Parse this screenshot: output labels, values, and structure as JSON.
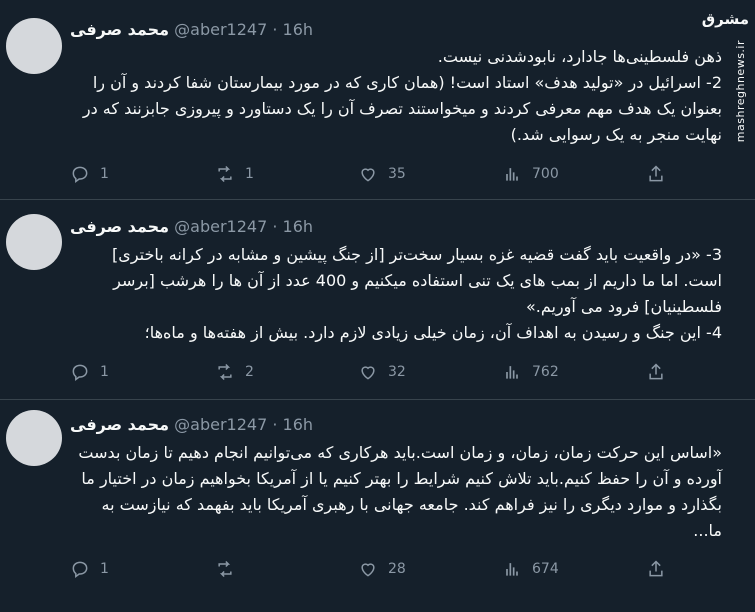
{
  "watermark": {
    "logo_text": "مشرق",
    "site": "mashreghnews.ir"
  },
  "tweets": [
    {
      "name": "محمد صرفی",
      "handle": "@aber1247",
      "time": "16h",
      "lines": [
        "ذهن فلسطینی‌ها جادارد، نابودشدنی نیست.",
        "2- اسرائیل در «تولید هدف» استاد است! (همان کاری که در مورد بیمارستان شفا کردند و آن را بعنوان یک هدف مهم معرفی کردند و میخواستند تصرف آن را یک دستاورد و پیروزی جابزنند که در نهایت منجر به یک رسوایی شد.)"
      ],
      "replies": "1",
      "retweets": "1",
      "likes": "35",
      "views": "700"
    },
    {
      "name": "محمد صرفی",
      "handle": "@aber1247",
      "time": "16h",
      "lines": [
        "3- «در واقعیت باید گفت قضیه غزه بسیار سخت‌تر [از جنگ پیشین و مشابه در کرانه باختری] است. اما ما داریم از بمب های یک تنی استفاده میکنیم و 400 عدد از آن ها را هرشب [برسر فلسطینیان] فرود می آوریم.»",
        "4- این جنگ و رسیدن به اهداف آن، زمان خیلی زیادی لازم دارد. بیش از هفته‌ها و ماه‌ها؛"
      ],
      "replies": "1",
      "retweets": "2",
      "likes": "32",
      "views": "762"
    },
    {
      "name": "محمد صرفی",
      "handle": "@aber1247",
      "time": "16h",
      "lines": [
        "«اساس این حرکت زمان، زمان، و زمان است.باید هرکاری که می‌توانیم انجام دهیم تا زمان بدست آورده و آن را حفظ کنیم.باید تلاش کنیم شرایط را بهتر کنیم یا از آمریکا بخواهیم زمان در اختیار ما بگذارد و موارد دیگری را نیز فراهم کند. جامعه جهانی با رهبری آمریکا باید بفهمد که نیازست به ما..."
      ],
      "replies": "1",
      "retweets": "",
      "likes": "28",
      "views": "674"
    }
  ]
}
